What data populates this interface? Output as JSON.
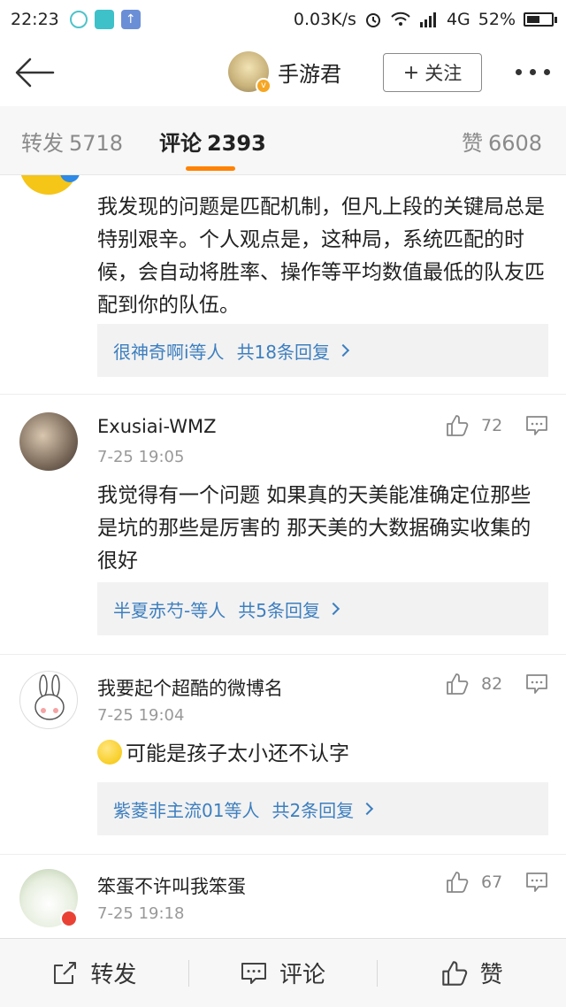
{
  "status_bar": {
    "time": "22:23",
    "network_speed": "0.03K/s",
    "network_type": "4G",
    "battery_percent": "52%",
    "battery_level": 0.52
  },
  "header": {
    "title": "手游君",
    "follow_label": "关注",
    "follow_plus": "+"
  },
  "tabs": [
    {
      "label": "转发",
      "count": "5718",
      "active": false
    },
    {
      "label": "评论",
      "count": "2393",
      "active": true
    },
    {
      "label": "赞",
      "count": "6608",
      "active": false
    }
  ],
  "comments": [
    {
      "name": "",
      "time": "",
      "text": "我发现的问题是匹配机制，但凡上段的关键局总是特别艰辛。个人观点是，这种局，系统匹配的时候，会自动将胜率、操作等平均数值最低的队友匹配到你的队伍。",
      "reply_users": "很神奇啊i等人",
      "reply_count": "共18条回复"
    },
    {
      "name": "Exusiai-WMZ",
      "time": "7-25 19:05",
      "likes": "72",
      "text": "我觉得有一个问题  如果真的天美能准确定位那些是坑的那些是厉害的 那天美的大数据确实收集的很好",
      "reply_users": "半夏赤芍-等人",
      "reply_count": "共5条回复"
    },
    {
      "name": "我要起个超酷的微博名",
      "time": "7-25 19:04",
      "likes": "82",
      "text": "可能是孩子太小还不认字",
      "reply_users": "紫菱非主流01等人",
      "reply_count": "共2条回复"
    },
    {
      "name": "笨蛋不许叫我笨蛋",
      "time": "7-25 19:18",
      "likes": "67"
    }
  ],
  "bottom_bar": {
    "repost": "转发",
    "comment": "评论",
    "like": "赞"
  },
  "colors": {
    "accent": "#ff8200",
    "link": "#3d7fbf",
    "text": "#222222",
    "muted": "#999999"
  }
}
